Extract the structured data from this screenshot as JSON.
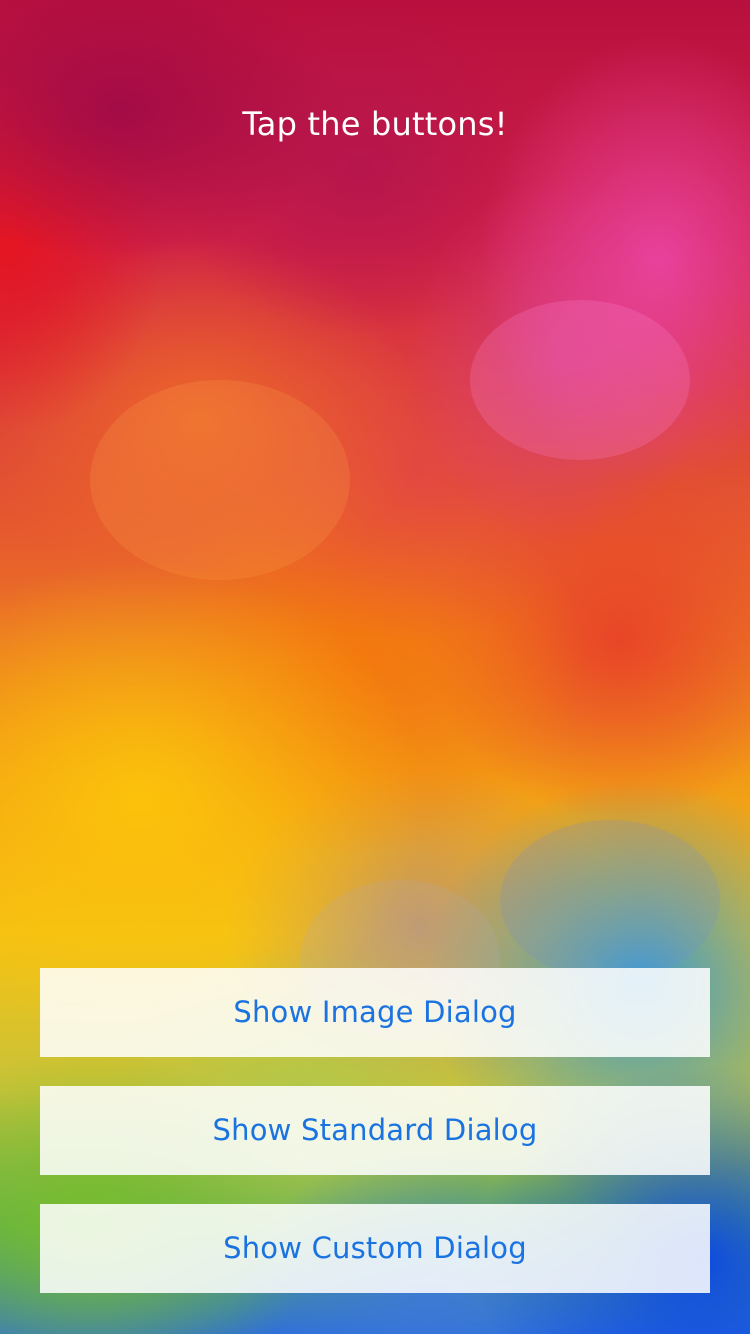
{
  "header": {
    "title": "Tap the buttons!"
  },
  "buttons": {
    "image_dialog": "Show Image Dialog",
    "standard_dialog": "Show Standard Dialog",
    "custom_dialog": "Show Custom Dialog"
  },
  "colors": {
    "button_text": "#1a73e0",
    "title_text": "#ffffff"
  }
}
